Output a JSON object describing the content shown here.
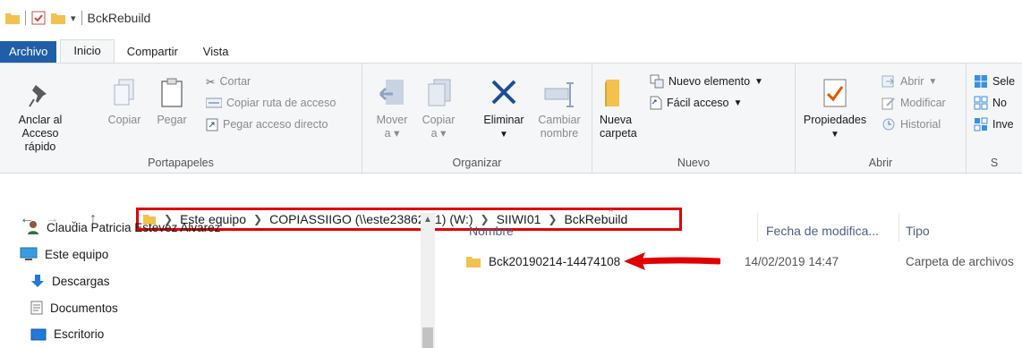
{
  "window": {
    "title": "BckRebuild"
  },
  "tabs": [
    {
      "label": "Archivo"
    },
    {
      "label": "Inicio"
    },
    {
      "label": "Compartir"
    },
    {
      "label": "Vista"
    }
  ],
  "ribbon": {
    "portapapeles": {
      "label": "Portapapeles",
      "pin_line1": "Anclar al",
      "pin_line2": "Acceso rápido",
      "copy": "Copiar",
      "paste": "Pegar",
      "cut": "Cortar",
      "copy_path": "Copiar ruta de acceso",
      "paste_shortcut": "Pegar acceso directo"
    },
    "organizar": {
      "label": "Organizar",
      "move_line1": "Mover",
      "move_line2": "a",
      "copy_line1": "Copiar",
      "copy_line2": "a",
      "delete": "Eliminar",
      "rename_line1": "Cambiar",
      "rename_line2": "nombre"
    },
    "nuevo": {
      "label": "Nuevo",
      "new_folder_line1": "Nueva",
      "new_folder_line2": "carpeta",
      "new_item": "Nuevo elemento",
      "easy_access": "Fácil acceso"
    },
    "abrir": {
      "label": "Abrir",
      "properties": "Propiedades",
      "open": "Abrir",
      "edit": "Modificar",
      "history": "Historial"
    },
    "seleccionar": {
      "label": "S",
      "select_all": "Sele",
      "select_none": "No",
      "invert": "Inve"
    }
  },
  "address": {
    "crumbs": [
      "Este equipo",
      "COPIASSIIGO (\\\\este23862-11) (W:)",
      "SIIWI01",
      "BckRebuild"
    ]
  },
  "navpane": {
    "items": [
      {
        "label": "Claudia Patricia Estevez Alvarez"
      },
      {
        "label": "Este equipo"
      },
      {
        "label": "Descargas"
      },
      {
        "label": "Documentos"
      },
      {
        "label": "Escritorio"
      }
    ]
  },
  "filelist": {
    "columns": [
      "Nombre",
      "Fecha de modifica...",
      "Tipo"
    ],
    "rows": [
      {
        "name": "Bck20190214-14474108",
        "date": "14/02/2019 14:47",
        "type": "Carpeta de archivos"
      }
    ]
  },
  "colors": {
    "accent": "#1f5fa8",
    "highlight": "#e00000",
    "folder": "#f2c14e"
  }
}
